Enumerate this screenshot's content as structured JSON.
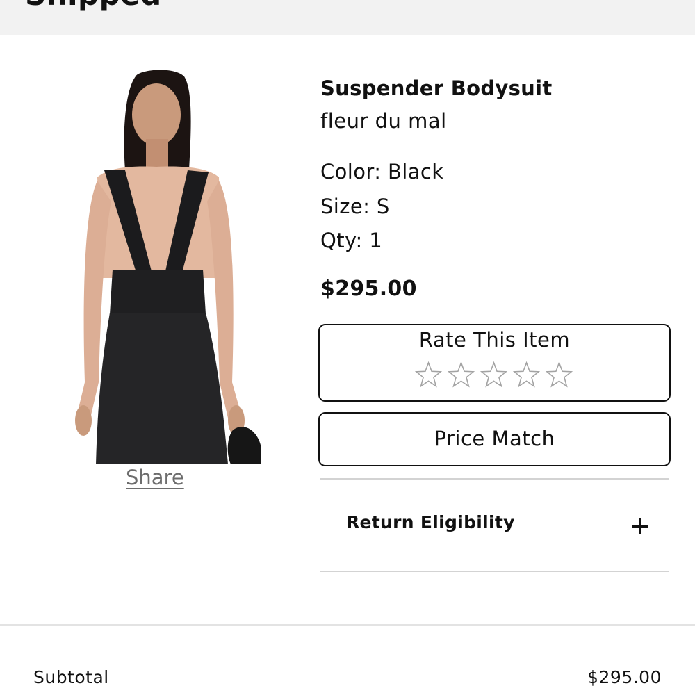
{
  "header": {
    "status_title": "Shipped"
  },
  "product": {
    "name": "Suspender Bodysuit",
    "brand": "fleur du mal",
    "color": "Color: Black",
    "size": "Size: S",
    "qty": "Qty: 1",
    "price": "$295.00",
    "share_label": "Share"
  },
  "rating": {
    "title": "Rate This Item",
    "stars_total": 5,
    "stars_selected": 0
  },
  "price_match": {
    "label": "Price Match"
  },
  "return_eligibility": {
    "label": "Return Eligibility",
    "icon": "plus-icon"
  },
  "summary": {
    "subtotal_label": "Subtotal",
    "subtotal_value": "$295.00"
  }
}
